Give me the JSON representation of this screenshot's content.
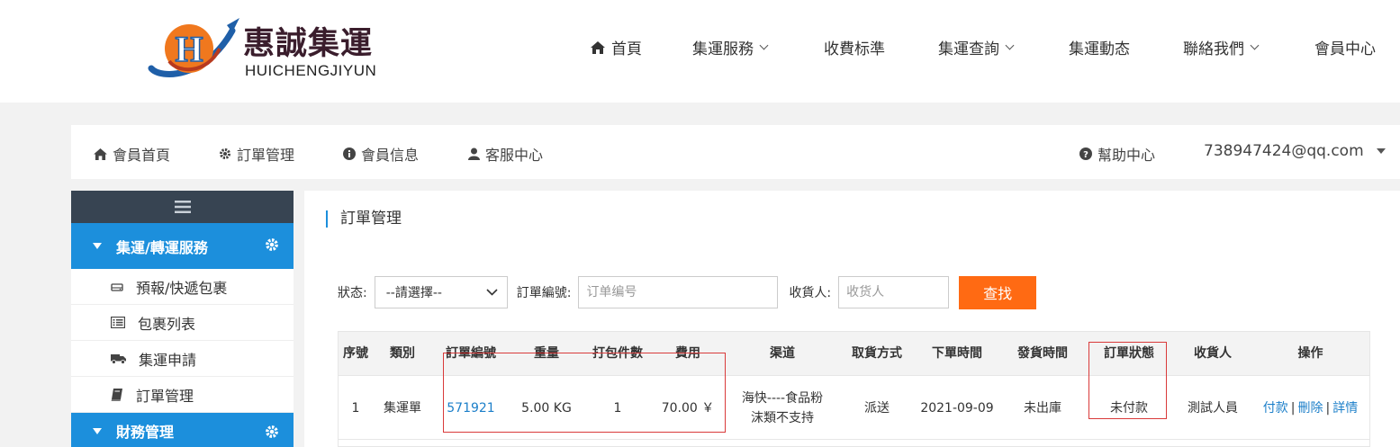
{
  "brand": {
    "name": "惠誠集運",
    "sub": "HUICHENGJIYUN",
    "logo_letter": "H",
    "colors": {
      "orange": "#f0781e",
      "blue": "#1f5fa8",
      "dark": "#3a1d2c"
    }
  },
  "nav": {
    "items": [
      {
        "label": "首頁",
        "icon": "home-icon"
      },
      {
        "label": "集運服務",
        "dropdown": true
      },
      {
        "label": "收費标準"
      },
      {
        "label": "集運查詢",
        "dropdown": true
      },
      {
        "label": "集運動态"
      },
      {
        "label": "聯絡我們",
        "dropdown": true
      },
      {
        "label": "會員中心"
      }
    ]
  },
  "member_bar": {
    "items": [
      {
        "label": "會員首頁",
        "icon": "home-icon"
      },
      {
        "label": "訂單管理",
        "icon": "gear-icon"
      },
      {
        "label": "會員信息",
        "icon": "info-icon"
      },
      {
        "label": "客服中心",
        "icon": "user-icon"
      }
    ],
    "help": "幫助中心",
    "user": "738947424@qq.com"
  },
  "sidebar": {
    "groups": [
      {
        "label": "集運/轉運服務",
        "items": [
          {
            "label": "預報/快遞包裹",
            "icon": "drive-icon"
          },
          {
            "label": "包裹列表",
            "icon": "list-icon"
          },
          {
            "label": "集運申請",
            "icon": "truck-icon"
          },
          {
            "label": "訂單管理",
            "icon": "book-icon"
          }
        ]
      },
      {
        "label": "財務管理",
        "items": []
      }
    ]
  },
  "main": {
    "title": "訂單管理",
    "filters": {
      "status_label": "狀态:",
      "status_value": "--請選擇--",
      "order_label": "訂單編號:",
      "order_placeholder": "订单编号",
      "receiver_label": "收貨人:",
      "receiver_placeholder": "收货人",
      "search_button": "查找"
    },
    "table": {
      "headers": [
        "序號",
        "類別",
        "訂單編號",
        "重量",
        "打包件數",
        "費用",
        "渠道",
        "取貨方式",
        "下單時間",
        "發貨時間",
        "訂單狀態",
        "收貨人",
        "操作"
      ],
      "rows": [
        {
          "index": "1",
          "type": "集運單",
          "order_no": "571921",
          "weight": "5.00 KG",
          "packages": "1",
          "fee": "70.00 ￥",
          "channel_line1": "海快----食品粉",
          "channel_line2": "沫類不支持",
          "pickup": "派送",
          "order_time": "2021-09-09",
          "ship_time": "未出庫",
          "status": "未付款",
          "receiver": "測試人員",
          "actions": [
            "付款",
            "刪除",
            "詳情"
          ]
        }
      ]
    }
  },
  "colors": {
    "accent_blue": "#1c8fdc",
    "search_orange": "#ff6a13",
    "sidebar_head": "#374452",
    "highlight_red": "#d93a3a"
  }
}
